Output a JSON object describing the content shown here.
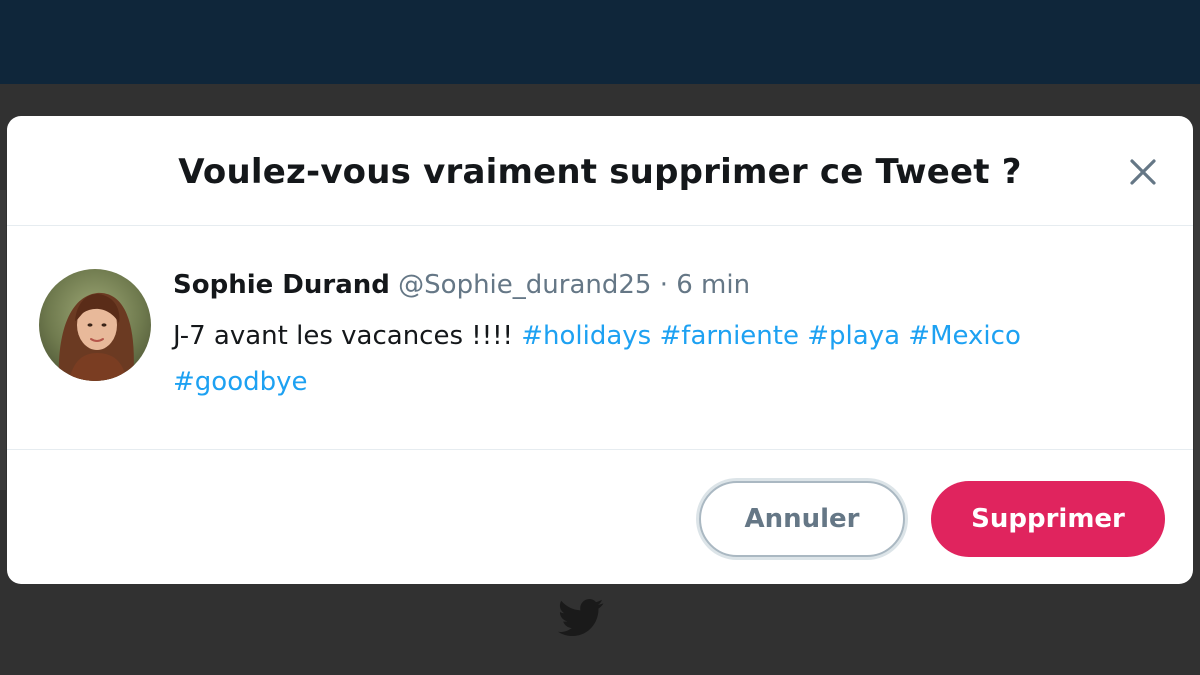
{
  "modal": {
    "title": "Voulez-vous vraiment supprimer ce Tweet ?",
    "close_icon": "close-icon"
  },
  "tweet": {
    "author_name": "Sophie Durand",
    "handle": "@Sophie_durand25",
    "separator": "·",
    "time": "6 min",
    "text": "J-7 avant les vacances !!!!",
    "hashtags": [
      "#holidays",
      "#farniente",
      "#playa",
      "#Mexico",
      "#goodbye"
    ]
  },
  "actions": {
    "cancel_label": "Annuler",
    "delete_label": "Supprimer"
  },
  "footer": {
    "logo_icon": "twitter-bird-icon"
  },
  "colors": {
    "topbar": "#0f263a",
    "overlay": "#313131",
    "accent_blue": "#1da1f2",
    "delete_red": "#e0245e",
    "text_primary": "#14171a",
    "text_secondary": "#657786"
  }
}
